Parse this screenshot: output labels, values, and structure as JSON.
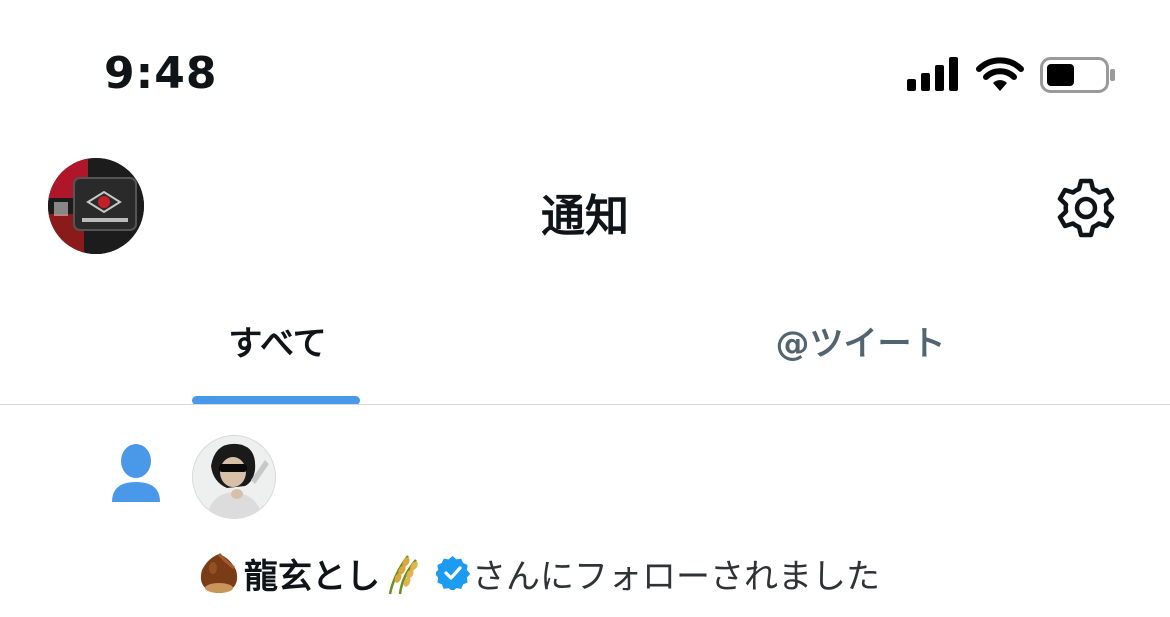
{
  "status_bar": {
    "time": "9:48",
    "icons": [
      "cellular-signal-icon",
      "wifi-icon",
      "battery-icon"
    ]
  },
  "header": {
    "title": "通知",
    "avatar": "profile-avatar",
    "settings_icon": "gear-icon"
  },
  "tabs": [
    {
      "label": "すべて",
      "active": true
    },
    {
      "label": "@ツイート",
      "active": false
    }
  ],
  "notifications": [
    {
      "type_icon": "person-icon",
      "avatar": "follower-avatar",
      "user_name": "龍玄とし",
      "name_emojis": [
        "chestnut-emoji",
        "rice-ear-emoji"
      ],
      "verified": true,
      "text": "さんにフォローされました"
    }
  ],
  "colors": {
    "accent": "#4a99e9",
    "text_primary": "#0f1419",
    "text_secondary": "#536471",
    "divider": "#d6d9db"
  }
}
